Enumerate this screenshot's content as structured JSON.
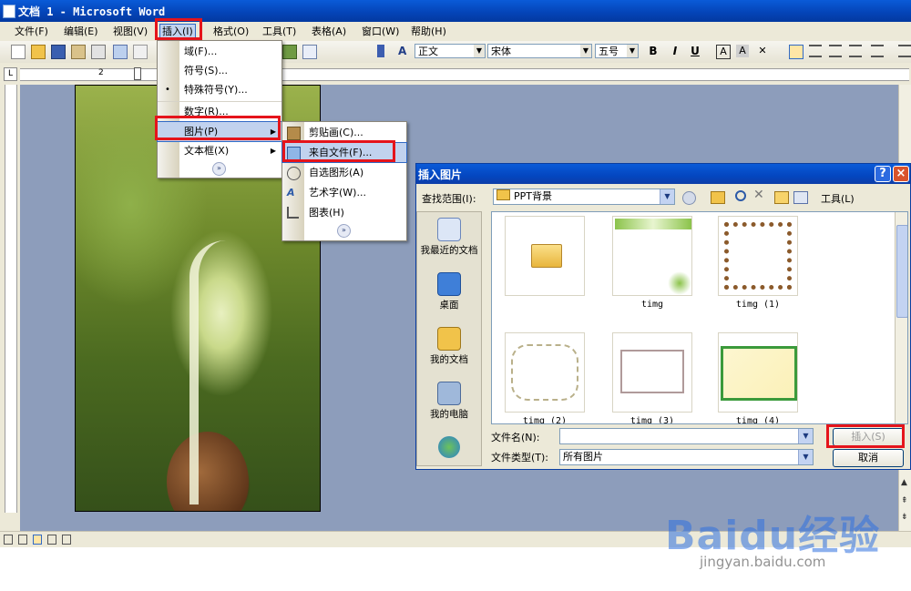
{
  "window": {
    "title": "文档 1 - Microsoft Word"
  },
  "menubar": [
    "文件(F)",
    "编辑(E)",
    "视图(V)",
    "插入(I)",
    "格式(O)",
    "工具(T)",
    "表格(A)",
    "窗口(W)",
    "帮助(H)"
  ],
  "toolbar": {
    "style": "正文",
    "font": "宋体",
    "size": "五号",
    "bold": "B",
    "italic": "I",
    "underline": "U",
    "font_color": "A"
  },
  "ruler": {
    "tick_2": "2",
    "tick_ll": "L"
  },
  "insert_menu": {
    "items": [
      "域(F)...",
      "符号(S)...",
      "特殊符号(Y)...",
      "数字(R)...",
      "图片(P)",
      "文本框(X)"
    ],
    "expand": "»"
  },
  "picture_menu": {
    "items": [
      "剪贴画(C)...",
      "来自文件(F)...",
      "自选图形(A)",
      "艺术字(W)...",
      "图表(H)"
    ],
    "expand": "»"
  },
  "dialog": {
    "title": "插入图片",
    "look_in_label": "查找范围(I):",
    "look_in_value": "PPT背景",
    "tools_label": "工具(L)",
    "places": [
      "我最近的文档",
      "桌面",
      "我的文档",
      "我的电脑"
    ],
    "files": [
      "",
      "timg",
      "timg (1)",
      "timg (2)",
      "timg (3)",
      "timg (4)"
    ],
    "filename_label": "文件名(N):",
    "filename_value": "",
    "filetype_label": "文件类型(T):",
    "filetype_value": "所有图片",
    "insert_button": "插入(S)",
    "cancel_button": "取消",
    "help": "?",
    "close": "×"
  },
  "watermark": {
    "brand": "Baidu经验",
    "url": "jingyan.baidu.com"
  }
}
